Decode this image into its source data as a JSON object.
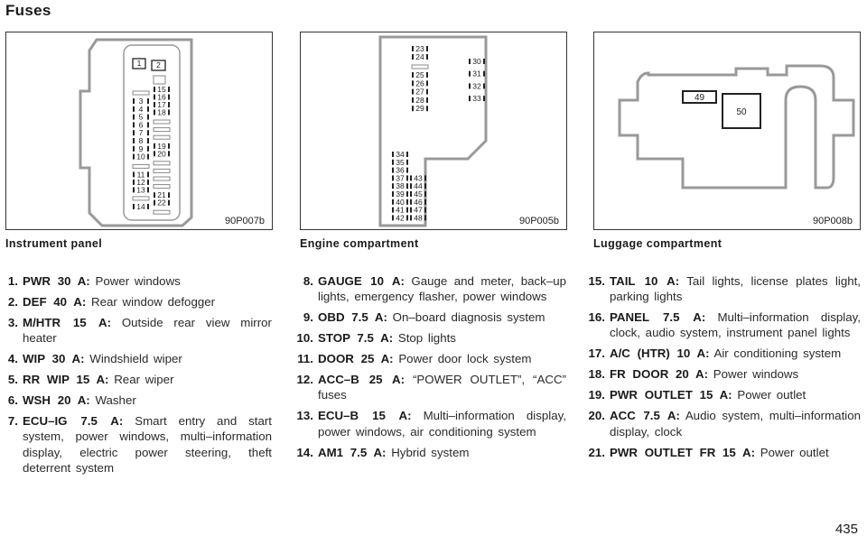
{
  "page": {
    "title": "Fuses",
    "page_number": "435"
  },
  "panels": [
    {
      "id": "instrument",
      "caption": "Instrument panel",
      "code": "90P007b",
      "large_fuses": [
        "1",
        "2"
      ],
      "left_column_fuses": [
        "3",
        "4",
        "5",
        "6",
        "7",
        "8",
        "9",
        "10",
        "11",
        "12",
        "13",
        "14"
      ],
      "right_column_fuses": [
        "15",
        "16",
        "17",
        "18",
        "19",
        "20",
        "21",
        "22"
      ]
    },
    {
      "id": "engine",
      "caption": "Engine compartment",
      "code": "90P005b",
      "top_left_fuses": [
        "23",
        "24",
        "25",
        "26",
        "27",
        "28",
        "29"
      ],
      "top_right_fuses": [
        "30",
        "31",
        "32",
        "33"
      ],
      "bottom_left_fuses": [
        "34",
        "35",
        "36",
        "37",
        "38",
        "39",
        "40",
        "41",
        "42"
      ],
      "bottom_right_fuses": [
        "43",
        "44",
        "45",
        "46",
        "47",
        "48"
      ]
    },
    {
      "id": "luggage",
      "caption": "Luggage compartment",
      "code": "90P008b",
      "fuses": [
        "49",
        "50"
      ]
    }
  ],
  "fuse_list": [
    [
      {
        "num": "1.",
        "name": "PWR 30 A:",
        "desc": "Power windows"
      },
      {
        "num": "2.",
        "name": "DEF 40 A:",
        "desc": "Rear window defogger"
      },
      {
        "num": "3.",
        "name": "M/HTR 15 A:",
        "desc": "Outside rear view mirror heater"
      },
      {
        "num": "4.",
        "name": "WIP 30 A:",
        "desc": "Windshield wiper"
      },
      {
        "num": "5.",
        "name": "RR WIP 15 A:",
        "desc": "Rear wiper"
      },
      {
        "num": "6.",
        "name": "WSH 20 A:",
        "desc": "Washer"
      },
      {
        "num": "7.",
        "name": "ECU–IG 7.5 A:",
        "desc": "Smart entry and start system, power windows, multi–information display, electric power steering, theft deterrent system"
      }
    ],
    [
      {
        "num": "8.",
        "name": "GAUGE 10 A:",
        "desc": "Gauge and meter, back–up lights, emergency flasher, power windows"
      },
      {
        "num": "9.",
        "name": "OBD 7.5 A:",
        "desc": "On–board diagnosis system"
      },
      {
        "num": "10.",
        "name": "STOP 7.5 A:",
        "desc": "Stop lights"
      },
      {
        "num": "11.",
        "name": "DOOR 25 A:",
        "desc": "Power door lock system"
      },
      {
        "num": "12.",
        "name": "ACC–B 25 A:",
        "desc": "“POWER OUTLET”, “ACC” fuses"
      },
      {
        "num": "13.",
        "name": "ECU–B 15 A:",
        "desc": "Multi–information display, power windows, air conditioning system"
      },
      {
        "num": "14.",
        "name": "AM1 7.5 A:",
        "desc": "Hybrid system"
      }
    ],
    [
      {
        "num": "15.",
        "name": "TAIL 10 A:",
        "desc": "Tail lights, license plates light, parking lights"
      },
      {
        "num": "16.",
        "name": "PANEL 7.5 A:",
        "desc": "Multi–information display, clock, audio system, instrument panel lights"
      },
      {
        "num": "17.",
        "name": "A/C (HTR) 10 A:",
        "desc": "Air conditioning system"
      },
      {
        "num": "18.",
        "name": "FR DOOR 20 A:",
        "desc": "Power windows"
      },
      {
        "num": "19.",
        "name": "PWR OUTLET 15 A:",
        "desc": "Power outlet"
      },
      {
        "num": "20.",
        "name": "ACC 7.5 A:",
        "desc": "Audio system, multi–information display, clock"
      },
      {
        "num": "21.",
        "name": "PWR OUTLET FR 15 A:",
        "desc": "Power outlet"
      }
    ]
  ]
}
